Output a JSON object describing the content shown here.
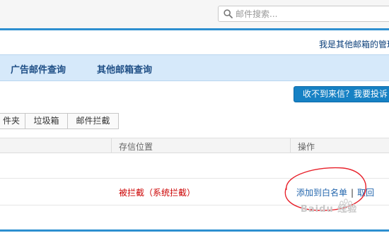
{
  "search": {
    "placeholder": "邮件搜索..."
  },
  "header": {
    "admin_text": "我是其他邮箱的管理"
  },
  "nav": {
    "items": [
      "广告邮件查询",
      "其他邮箱查询"
    ]
  },
  "complain_button": {
    "label": "收不到来信？我要投诉"
  },
  "tabs": [
    "件夹",
    "垃圾箱",
    "邮件拦截"
  ],
  "table": {
    "headers": [
      "存信位置",
      "操作"
    ],
    "rows": [
      {
        "status": "被拦截（系统拦截）",
        "actions": [
          "添加到白名单",
          "取回"
        ],
        "action_separator": "|"
      }
    ]
  },
  "watermark": {
    "text": "Baidu 经验"
  },
  "colors": {
    "accent_blue": "#2d8fd0",
    "nav_background": "#d6e9fa",
    "button_blue": "#1681c4",
    "status_red": "#cc0000",
    "annotation_red": "#e8202a"
  }
}
